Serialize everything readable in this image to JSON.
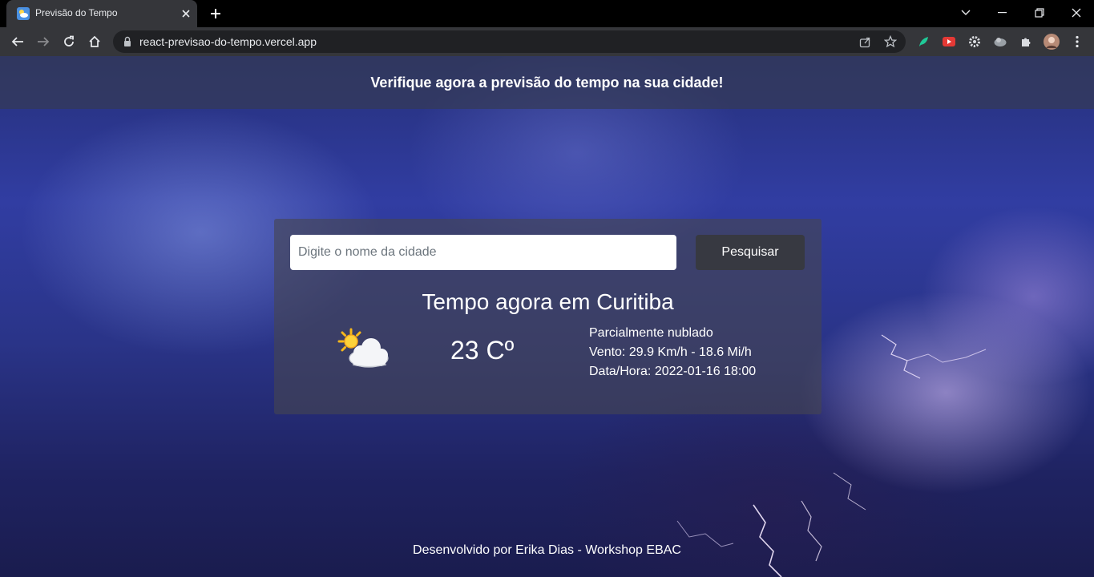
{
  "browser": {
    "tab_title": "Previsão do Tempo",
    "url": "react-previsao-do-tempo.vercel.app",
    "icons": [
      "weather-favicon",
      "close-icon",
      "plus-icon",
      "chevron-down-icon",
      "minimize-icon",
      "restore-icon",
      "close-window-icon",
      "back-arrow-icon",
      "forward-arrow-icon",
      "reload-icon",
      "home-icon",
      "lock-icon",
      "share-icon",
      "star-icon",
      "extension-icons",
      "puzzle-icon",
      "profile-avatar",
      "kebab-menu-icon"
    ]
  },
  "page": {
    "header_text": "Verifique agora a previsão do tempo na sua cidade!",
    "search": {
      "placeholder": "Digite o nome da cidade",
      "value": "",
      "button_label": "Pesquisar"
    },
    "weather": {
      "title": "Tempo agora em Curitiba",
      "icon": "partly-cloudy-icon",
      "temperature": "23 Cº",
      "condition": "Parcialmente nublado",
      "wind": "Vento: 29.9 Km/h - 18.6 Mi/h",
      "datetime": "Data/Hora: 2022-01-16 18:00"
    },
    "footer": "Desenvolvido por Erika Dias - Workshop EBAC"
  }
}
